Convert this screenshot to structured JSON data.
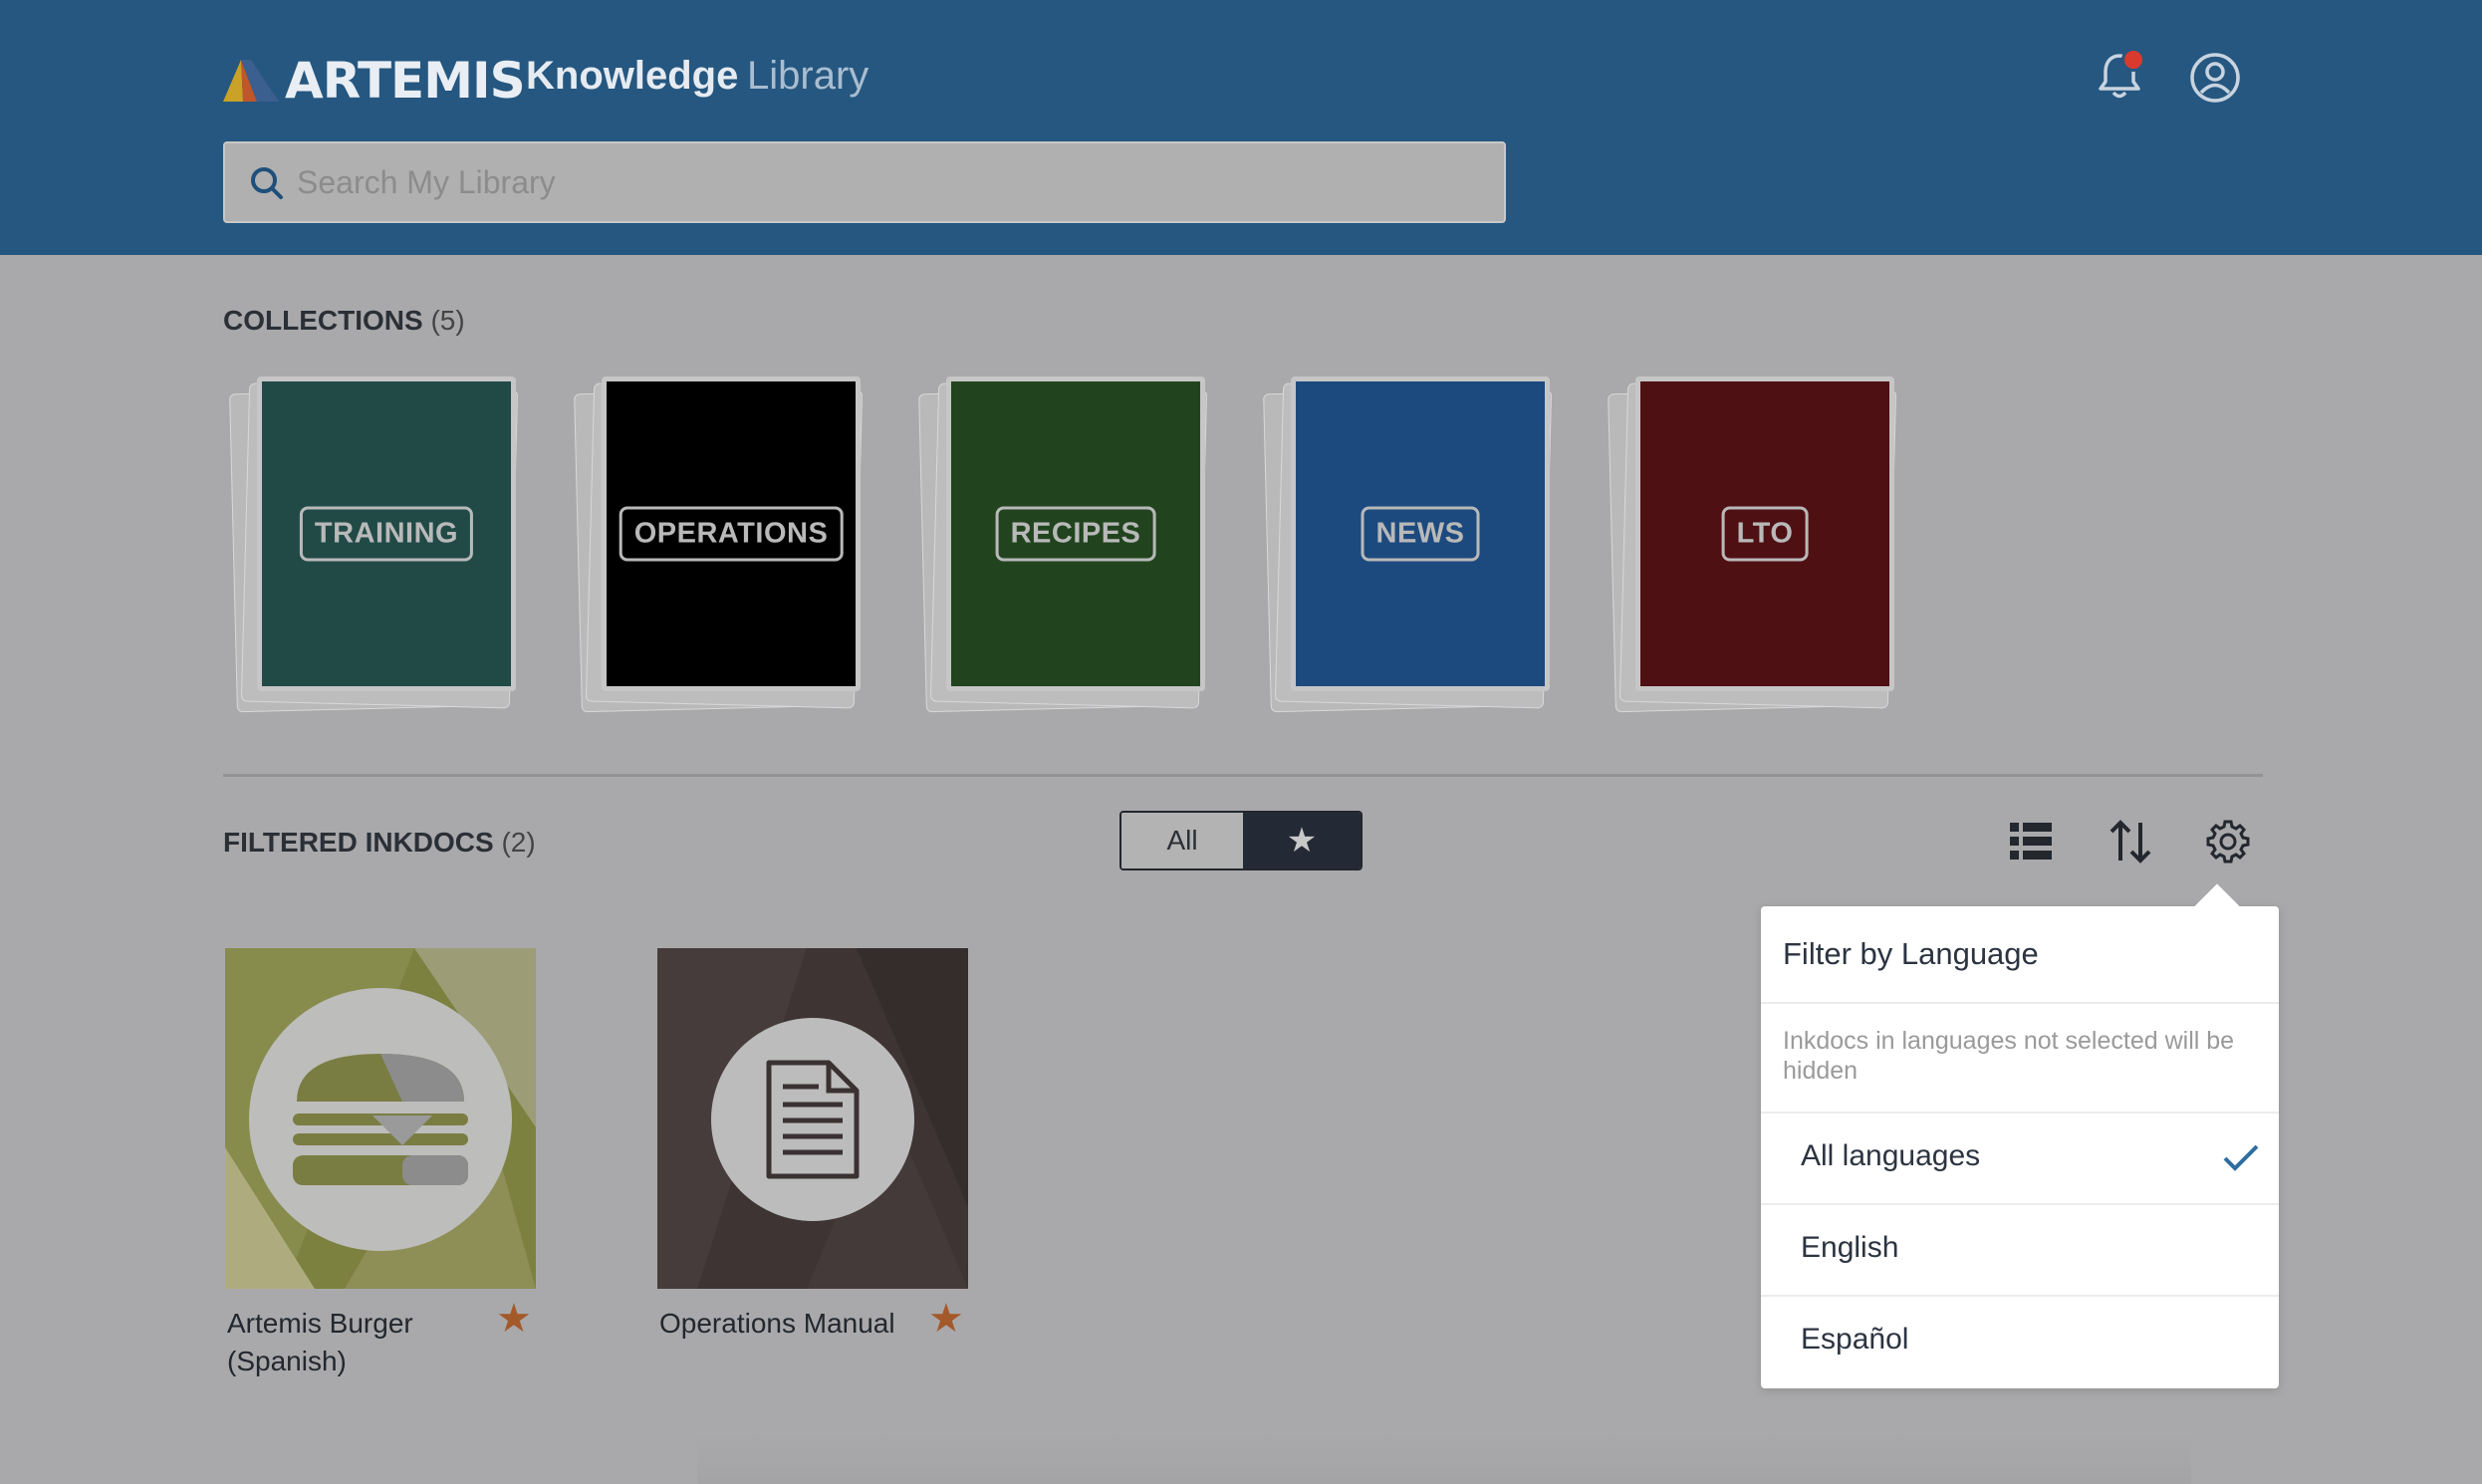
{
  "header": {
    "brand": "ARTEMIS",
    "app_name_1": "Knowledge",
    "app_name_2": "Library",
    "search_placeholder": "Search My Library",
    "notification_badge": true
  },
  "collections": {
    "label": "COLLECTIONS",
    "count": "(5)",
    "items": [
      {
        "label": "TRAINING",
        "color": "#214a47"
      },
      {
        "label": "OPERATIONS",
        "color": "#000000"
      },
      {
        "label": "RECIPES",
        "color": "#21441f"
      },
      {
        "label": "NEWS",
        "color": "#1c4a7e"
      },
      {
        "label": "LTO",
        "color": "#4f1014"
      }
    ]
  },
  "inkdocs": {
    "label": "FILTERED INKDOCS",
    "count": "(2)",
    "toggle": {
      "all_label": "All",
      "starred_icon": "star-icon",
      "selected": "starred"
    },
    "tools": [
      "list-view-icon",
      "sort-icon",
      "gear-icon"
    ],
    "items": [
      {
        "title": "Artemis Burger (Spanish)",
        "starred": true,
        "icon": "burger-icon"
      },
      {
        "title": "Operations Manual",
        "starred": true,
        "icon": "document-icon"
      }
    ]
  },
  "language_filter": {
    "title": "Filter by Language",
    "note": "Inkdocs in languages not selected will be hidden",
    "options": [
      {
        "label": "All languages",
        "selected": true
      },
      {
        "label": "English",
        "selected": false
      },
      {
        "label": "Español",
        "selected": false
      }
    ]
  },
  "colors": {
    "header_bg": "#255780",
    "overlay_bg": "#a9a9ab",
    "accent_star": "#a4592a",
    "check": "#2e6da0"
  }
}
